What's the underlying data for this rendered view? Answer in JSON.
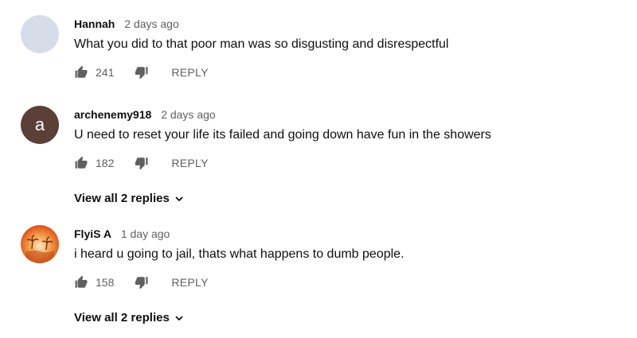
{
  "comments": [
    {
      "author": "Hannah",
      "time": "2 days ago",
      "text": "What you did to that poor man was so disgusting and disrespectful",
      "likes": "241",
      "reply_label": "REPLY",
      "avatar_type": "blank"
    },
    {
      "author": "archenemy918",
      "time": "2 days ago",
      "text": "U need to reset your life its failed and going down have fun in the showers",
      "likes": "182",
      "reply_label": "REPLY",
      "avatar_letter": "a",
      "avatar_type": "letter",
      "view_replies": "View all 2 replies"
    },
    {
      "author": "FlyiS A",
      "time": "1 day ago",
      "text": "i heard u going to jail, thats what happens to dumb people.",
      "likes": "158",
      "reply_label": "REPLY",
      "avatar_type": "photo",
      "view_replies": "View all 2 replies"
    }
  ],
  "icons": {
    "like": "thumbs-up-icon",
    "dislike": "thumbs-down-icon",
    "expand": "chevron-down-icon"
  },
  "colors": {
    "text": "#0f0f0f",
    "secondary": "#606060",
    "avatar_blank": "#d6dde9",
    "avatar_letter_bg": "#5a4036"
  }
}
